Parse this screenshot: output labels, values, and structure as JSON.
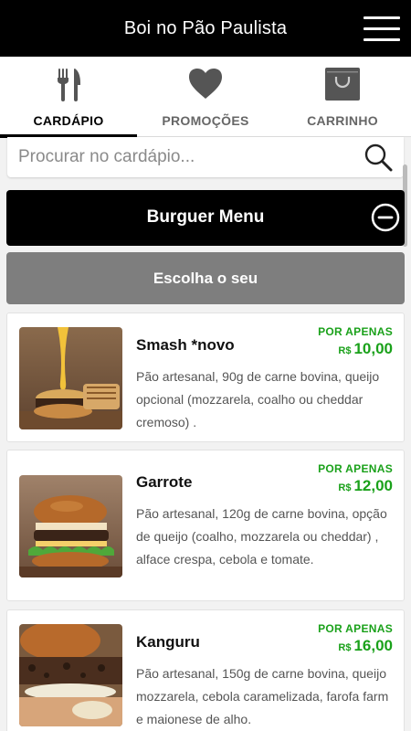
{
  "header": {
    "title": "Boi no Pão Paulista",
    "menu_icon": "hamburger-menu-icon"
  },
  "tabs": [
    {
      "label": "CARDÁPIO",
      "icon": "fork-knife-icon",
      "active": true
    },
    {
      "label": "PROMOÇÕES",
      "icon": "heart-icon",
      "active": false
    },
    {
      "label": "CARRINHO",
      "icon": "shopping-bag-icon",
      "active": false
    }
  ],
  "search": {
    "placeholder": "Procurar no cardápio...",
    "icon": "search-icon"
  },
  "category": {
    "label": "Burguer Menu",
    "icon": "collapse-minus-icon"
  },
  "subcategory": {
    "label": "Escolha o seu"
  },
  "products": [
    {
      "name": "Smash *novo",
      "price_tag": "POR APENAS",
      "currency": "R$",
      "price": "10,00",
      "description": "Pão artesanal, 90g de carne bovina, queijo opcional (mozzarela, coalho ou cheddar cremoso) ."
    },
    {
      "name": "Garrote",
      "price_tag": "POR APENAS",
      "currency": "R$",
      "price": "12,00",
      "description": "Pão artesanal, 120g de carne bovina, opção de queijo (coalho, mozzarela ou cheddar) , alface crespa, cebola e tomate."
    },
    {
      "name": "Kanguru",
      "price_tag": "POR APENAS",
      "currency": "R$",
      "price": "16,00",
      "description": "Pão artesanal, 150g de carne bovina, queijo mozzarela, cebola caramelizada, farofa farm e maionese de alho."
    }
  ],
  "colors": {
    "header_bg": "#000000",
    "price_green": "#1aa11a",
    "subcategory_bg": "#7e7e7e"
  }
}
